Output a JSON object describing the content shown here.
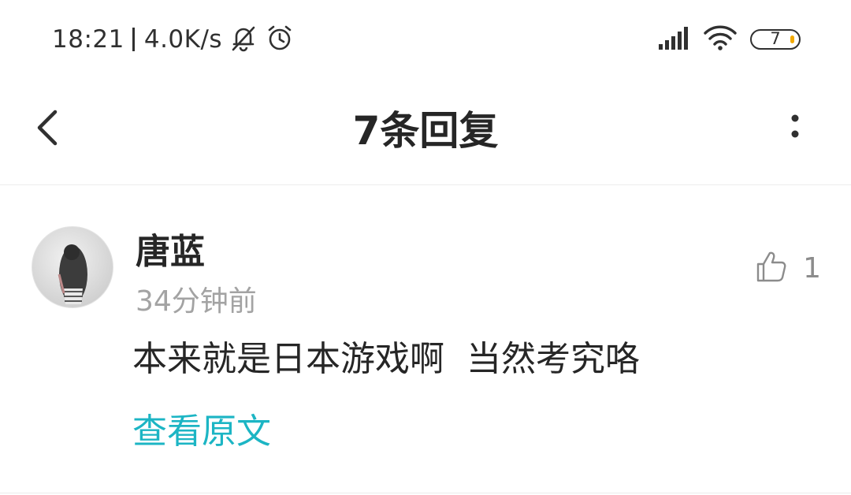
{
  "status_bar": {
    "time": "18:21",
    "net_speed": "4.0K/s",
    "battery_level": "7",
    "icons": [
      "notifications-muted-icon",
      "alarm-icon",
      "signal-icon",
      "wifi-icon",
      "battery-icon"
    ]
  },
  "nav": {
    "title": "7条回复",
    "icons": [
      "back-arrow-icon",
      "more-vertical-icon"
    ]
  },
  "comment": {
    "author": "唐蓝",
    "time": "34分钟前",
    "text": "本来就是日本游戏啊  当然考究咯",
    "like_count": "1",
    "view_original": "查看原文",
    "icons": [
      "avatar",
      "thumbs-up-icon"
    ]
  },
  "colors": {
    "link": "#1cb5c4",
    "secondary_text": "#a3a3a3",
    "primary_text": "#262626",
    "battery_accent": "#f2a900"
  }
}
